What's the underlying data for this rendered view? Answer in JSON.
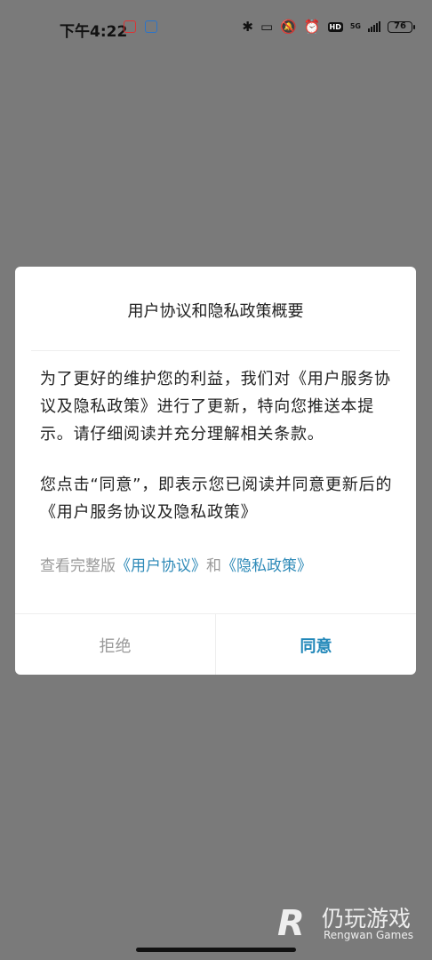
{
  "status_bar": {
    "time": "下午4:22",
    "network": "5G",
    "battery": "76"
  },
  "dialog": {
    "title": "用户协议和隐私政策概要",
    "paragraph1": "为了更好的维护您的利益，我们对《用户服务协议及隐私政策》进行了更新，特向您推送本提示。请仔细阅读并充分理解相关条款。",
    "paragraph2": "您点击“同意”，即表示您已阅读并同意更新后的 《用户服务协议及隐私政策》",
    "links_prefix": "查看完整版",
    "user_agreement_link": "《用户协议》",
    "links_and": "和",
    "privacy_policy_link": "《隐私政策》",
    "reject_label": "拒绝",
    "agree_label": "同意"
  },
  "watermark": {
    "logo": "R",
    "title": "仍玩游戏",
    "subtitle": "Rengwan Games"
  },
  "colors": {
    "overlay": "#7a7a7a",
    "link": "#2e8ab8",
    "agree": "#1f86b8"
  }
}
